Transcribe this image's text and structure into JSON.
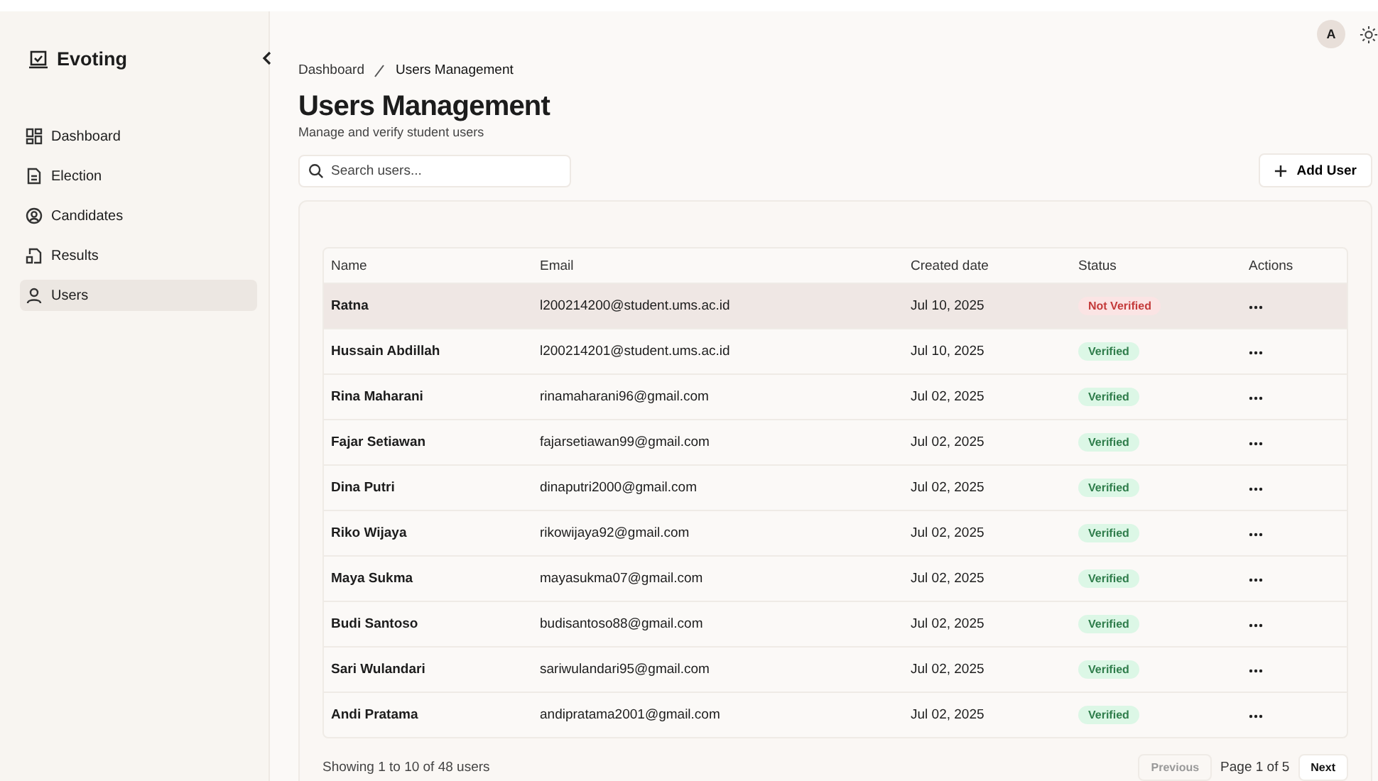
{
  "sidebar": {
    "brand": "Evoting",
    "items": [
      {
        "label": "Dashboard",
        "selected": false
      },
      {
        "label": "Election",
        "selected": false
      },
      {
        "label": "Candidates",
        "selected": false
      },
      {
        "label": "Results",
        "selected": false
      },
      {
        "label": "Users",
        "selected": true
      }
    ]
  },
  "header": {
    "avatar": "A"
  },
  "breadcrumb": [
    "Dashboard",
    "Users Management"
  ],
  "page": {
    "title": "Users Management",
    "subtitle": "Manage and verify student users"
  },
  "search": {
    "placeholder": "Search users..."
  },
  "add_button": "Add User",
  "table": {
    "columns": [
      "Name",
      "Email",
      "Created date",
      "Status",
      "Actions"
    ],
    "rows": [
      {
        "name": "Ratna",
        "email": "l200214200@student.ums.ac.id",
        "created": "Jul 10, 2025",
        "status": "Not Verified",
        "kind": "unverified",
        "selected": true
      },
      {
        "name": "Hussain Abdillah",
        "email": "l200214201@student.ums.ac.id",
        "created": "Jul 10, 2025",
        "status": "Verified",
        "kind": "verified",
        "selected": false
      },
      {
        "name": "Rina Maharani",
        "email": "rinamaharani96@gmail.com",
        "created": "Jul 02, 2025",
        "status": "Verified",
        "kind": "verified",
        "selected": false
      },
      {
        "name": "Fajar Setiawan",
        "email": "fajarsetiawan99@gmail.com",
        "created": "Jul 02, 2025",
        "status": "Verified",
        "kind": "verified",
        "selected": false
      },
      {
        "name": "Dina Putri",
        "email": "dinaputri2000@gmail.com",
        "created": "Jul 02, 2025",
        "status": "Verified",
        "kind": "verified",
        "selected": false
      },
      {
        "name": "Riko Wijaya",
        "email": "rikowijaya92@gmail.com",
        "created": "Jul 02, 2025",
        "status": "Verified",
        "kind": "verified",
        "selected": false
      },
      {
        "name": "Maya Sukma",
        "email": "mayasukma07@gmail.com",
        "created": "Jul 02, 2025",
        "status": "Verified",
        "kind": "verified",
        "selected": false
      },
      {
        "name": "Budi Santoso",
        "email": "budisantoso88@gmail.com",
        "created": "Jul 02, 2025",
        "status": "Verified",
        "kind": "verified",
        "selected": false
      },
      {
        "name": "Sari Wulandari",
        "email": "sariwulandari95@gmail.com",
        "created": "Jul 02, 2025",
        "status": "Verified",
        "kind": "verified",
        "selected": false
      },
      {
        "name": "Andi Pratama",
        "email": "andipratama2001@gmail.com",
        "created": "Jul 02, 2025",
        "status": "Verified",
        "kind": "verified",
        "selected": false
      }
    ]
  },
  "pagination": {
    "summary": "Showing 1 to 10 of 48 users",
    "previous": "Previous",
    "page": "Page 1 of 5",
    "next": "Next",
    "previous_disabled": true
  }
}
